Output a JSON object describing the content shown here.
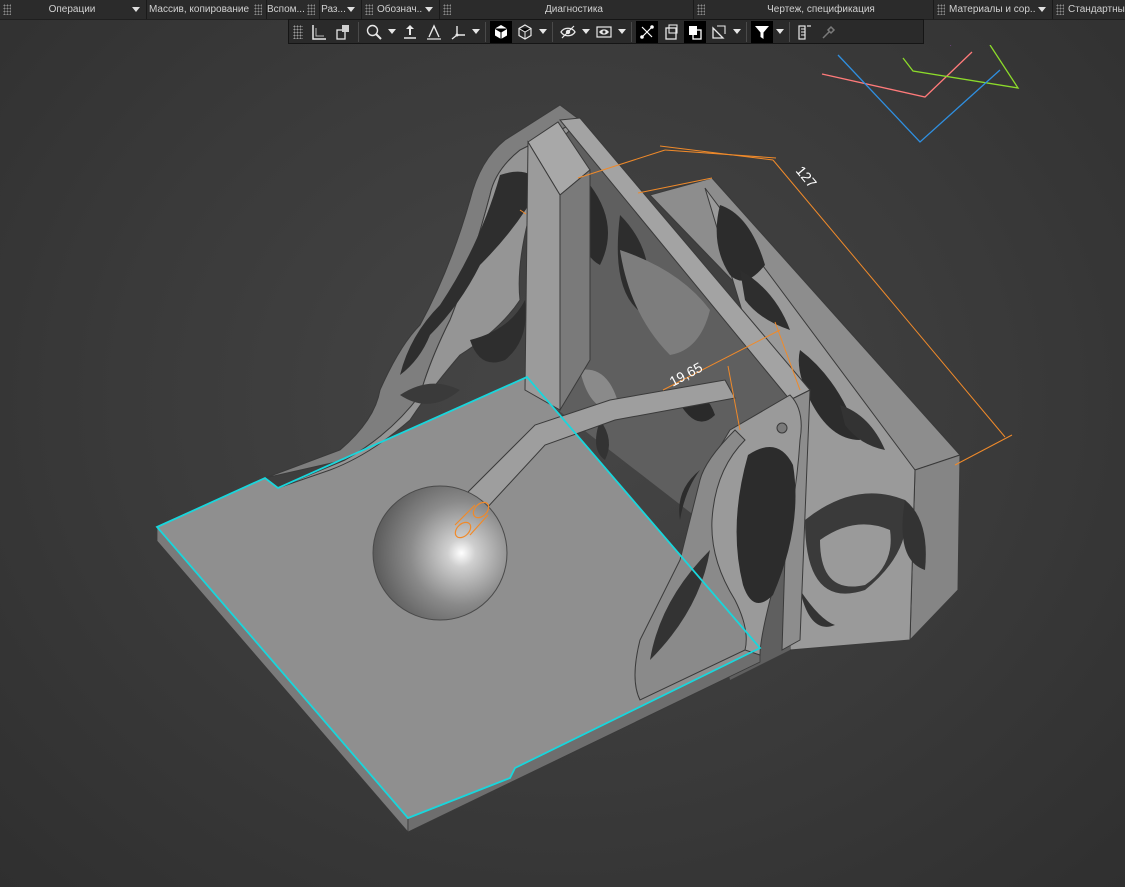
{
  "panels": [
    {
      "label": "Операции"
    },
    {
      "label": "Массив, копирование"
    },
    {
      "label": "Вспом..."
    },
    {
      "label": "Раз..."
    },
    {
      "label": "Обознач..."
    },
    {
      "label": "Диагностика"
    },
    {
      "label": "Чертеж, спецификация"
    },
    {
      "label": "Материалы и сор..."
    },
    {
      "label": "Стандартные и"
    }
  ],
  "dimensions": {
    "length": "127",
    "offset": "19,65"
  },
  "colors": {
    "selection": "#19d6dc",
    "dimension": "#f08a2a",
    "model": "#8e8e8e",
    "axis_x": "#ff7a7a",
    "axis_y": "#8cdb2a",
    "axis_z": "#2f8fe0",
    "axis_extra": "#cc55ff"
  }
}
